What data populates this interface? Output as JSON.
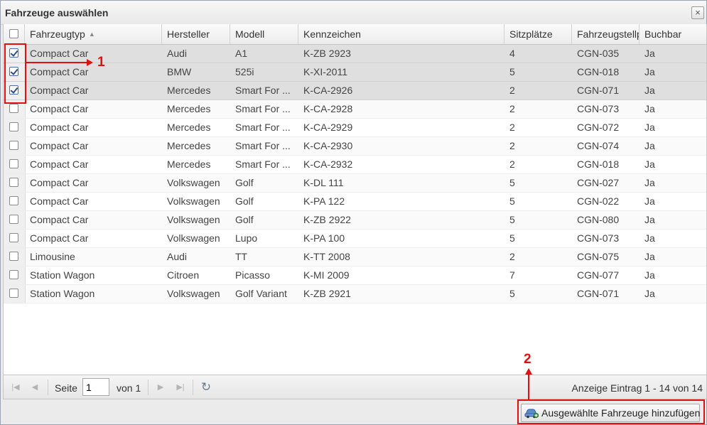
{
  "dialog": {
    "title": "Fahrzeuge auswählen",
    "close_glyph": "×"
  },
  "columns": [
    "Fahrzeugtyp",
    "Hersteller",
    "Modell",
    "Kennzeichen",
    "Sitzplätze",
    "Fahrzeugstellp",
    "Buchbar"
  ],
  "sort_indicator": "▲",
  "rows": [
    {
      "checked": true,
      "cells": [
        "Compact Car",
        "Audi",
        "A1",
        "K-ZB 2923",
        "4",
        "CGN-035",
        "Ja"
      ]
    },
    {
      "checked": true,
      "cells": [
        "Compact Car",
        "BMW",
        "525i",
        "K-XI-2011",
        "5",
        "CGN-018",
        "Ja"
      ]
    },
    {
      "checked": true,
      "cells": [
        "Compact Car",
        "Mercedes",
        "Smart For ...",
        "K-CA-2926",
        "2",
        "CGN-071",
        "Ja"
      ]
    },
    {
      "checked": false,
      "cells": [
        "Compact Car",
        "Mercedes",
        "Smart For ...",
        "K-CA-2928",
        "2",
        "CGN-073",
        "Ja"
      ]
    },
    {
      "checked": false,
      "cells": [
        "Compact Car",
        "Mercedes",
        "Smart For ...",
        "K-CA-2929",
        "2",
        "CGN-072",
        "Ja"
      ]
    },
    {
      "checked": false,
      "cells": [
        "Compact Car",
        "Mercedes",
        "Smart For ...",
        "K-CA-2930",
        "2",
        "CGN-074",
        "Ja"
      ]
    },
    {
      "checked": false,
      "cells": [
        "Compact Car",
        "Mercedes",
        "Smart For ...",
        "K-CA-2932",
        "2",
        "CGN-018",
        "Ja"
      ]
    },
    {
      "checked": false,
      "cells": [
        "Compact Car",
        "Volkswagen",
        "Golf",
        "K-DL 111",
        "5",
        "CGN-027",
        "Ja"
      ]
    },
    {
      "checked": false,
      "cells": [
        "Compact Car",
        "Volkswagen",
        "Golf",
        "K-PA 122",
        "5",
        "CGN-022",
        "Ja"
      ]
    },
    {
      "checked": false,
      "cells": [
        "Compact Car",
        "Volkswagen",
        "Golf",
        "K-ZB 2922",
        "5",
        "CGN-080",
        "Ja"
      ]
    },
    {
      "checked": false,
      "cells": [
        "Compact Car",
        "Volkswagen",
        "Lupo",
        "K-PA 100",
        "5",
        "CGN-073",
        "Ja"
      ]
    },
    {
      "checked": false,
      "cells": [
        "Limousine",
        "Audi",
        "TT",
        "K-TT 2008",
        "2",
        "CGN-075",
        "Ja"
      ]
    },
    {
      "checked": false,
      "cells": [
        "Station Wagon",
        "Citroen",
        "Picasso",
        "K-MI 2009",
        "7",
        "CGN-077",
        "Ja"
      ]
    },
    {
      "checked": false,
      "cells": [
        "Station Wagon",
        "Volkswagen",
        "Golf Variant",
        "K-ZB 2921",
        "5",
        "CGN-071",
        "Ja"
      ]
    }
  ],
  "pager": {
    "page_label": "Seite",
    "page_value": "1",
    "of_label": "von 1",
    "info": "Anzeige Eintrag 1 - 14 von 14",
    "icons": {
      "first": "first-page-icon",
      "prev": "prev-page-icon",
      "next": "next-page-icon",
      "last": "last-page-icon",
      "refresh": "refresh-icon"
    }
  },
  "add_button": {
    "label": "Ausgewählte Fahrzeuge hinzufügen",
    "icon": "car-add-icon"
  },
  "annotations": [
    "1",
    "2"
  ],
  "colors": {
    "annotation": "#e01010",
    "selected_row": "#dfdfdf"
  }
}
